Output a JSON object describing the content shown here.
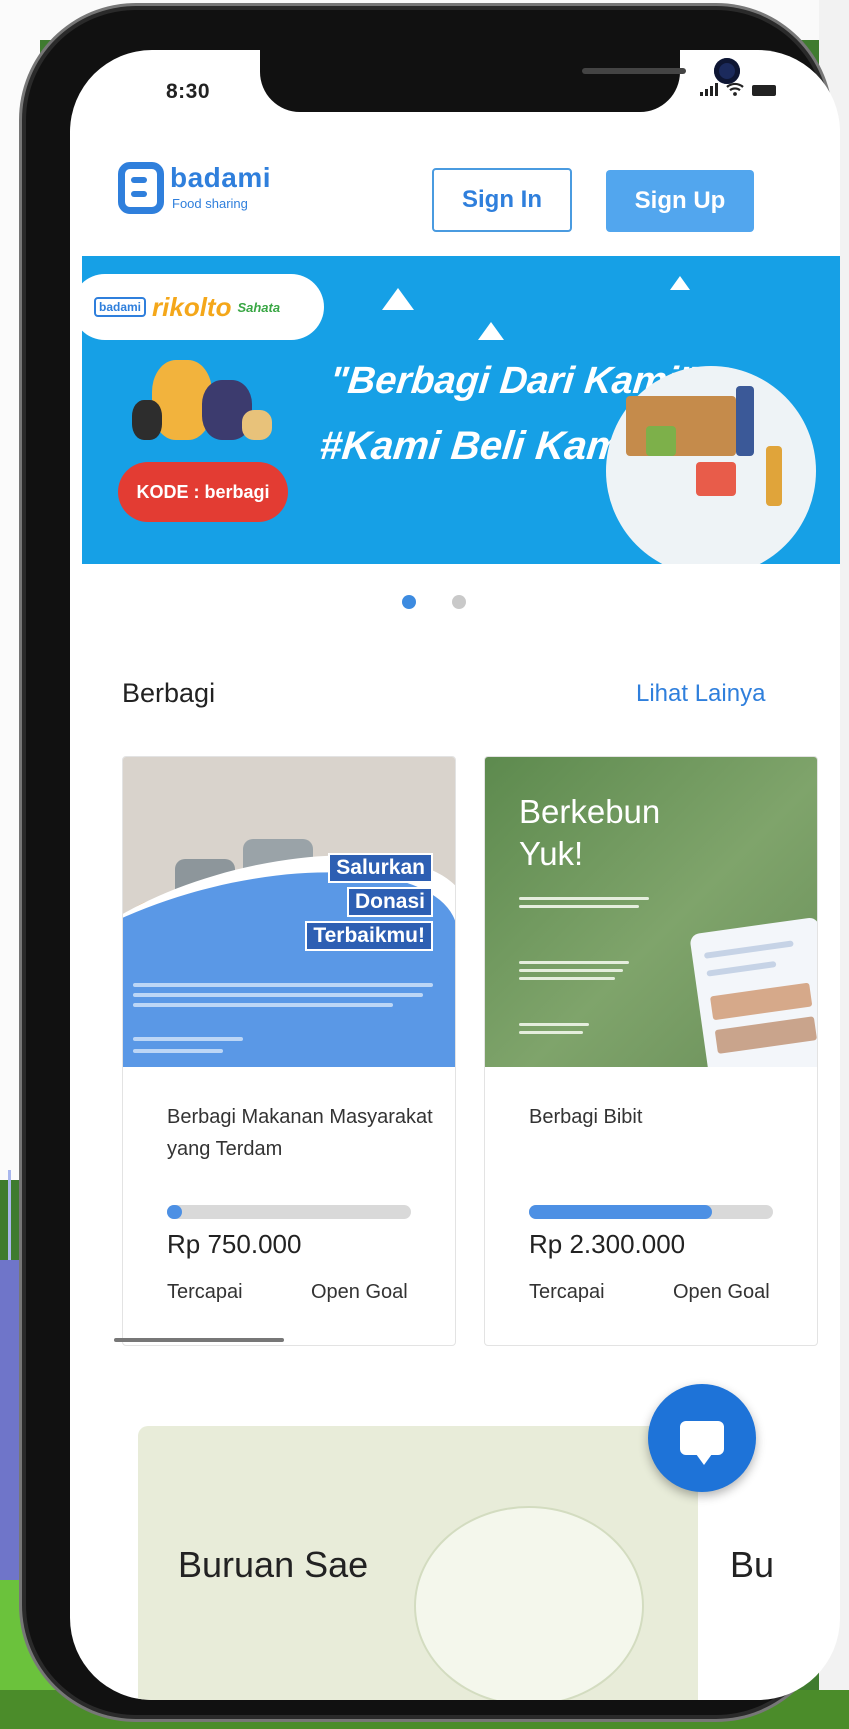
{
  "status_bar": {
    "time": "8:30"
  },
  "header": {
    "logo_name": "badami",
    "logo_tagline": "Food sharing",
    "sign_in_label": "Sign In",
    "sign_up_label": "Sign Up"
  },
  "banner": {
    "partner_badami": "badami",
    "partner_rikolto": "rikolto",
    "partner_sahata": "Sahata",
    "headline_line1": "\"Berbagi Dari Kami\"",
    "headline_line2": "#Kami Beli Kami bagi",
    "code_label": "KODE : berbagi",
    "carousel_pages": 2,
    "carousel_active_index": 0
  },
  "section": {
    "title": "Berbagi",
    "more_link": "Lihat Lainya"
  },
  "cards": [
    {
      "image_tags": [
        "Salurkan",
        "Donasi",
        "Terbaikmu!"
      ],
      "title": "Berbagi Makanan Masyarakat yang Terdam",
      "progress_fraction": 0.06,
      "amount": "Rp 750.000",
      "reached_label": "Tercapai",
      "goal_label": "Open Goal"
    },
    {
      "image_headline_1": "Berkebun",
      "image_headline_2": "Yuk!",
      "title": "Berbagi Bibit",
      "progress_fraction": 0.75,
      "amount": "Rp 2.300.000",
      "reached_label": "Tercapai",
      "goal_label": "Open Goal"
    }
  ],
  "bottom_section": {
    "card_title": "Buruan Sae",
    "next_card_title_partial": "Bu"
  },
  "colors": {
    "primary": "#2f7fdc",
    "button_fill": "#52a6ee",
    "banner_bg": "#16a0e6",
    "fab": "#1e73d8",
    "progress_fill": "#4d90e4"
  },
  "icons": {
    "chat_fab": "chat-bubble-icon",
    "signal": "signal-icon",
    "wifi": "wifi-icon",
    "battery": "battery-icon"
  }
}
